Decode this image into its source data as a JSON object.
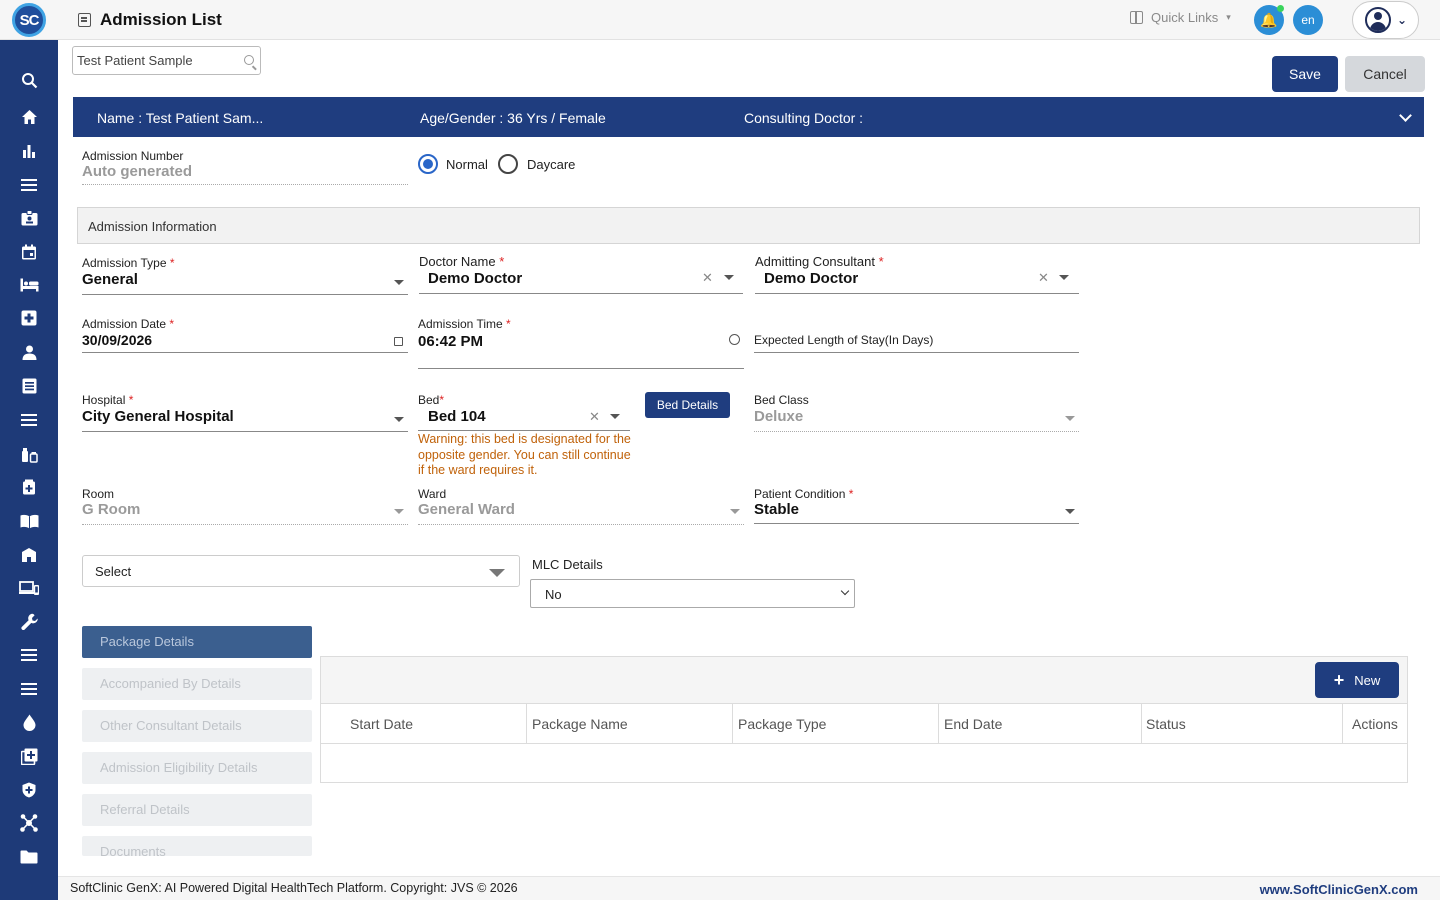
{
  "header": {
    "logo_text": "SC",
    "title": "Admission List",
    "quick_links": "Quick Links",
    "lang": "en"
  },
  "sidebar": {
    "items": [
      "search-icon",
      "home-icon",
      "chart-icon",
      "menu-icon",
      "id-badge-icon",
      "calendar-icon",
      "bed-icon",
      "medical-plus-icon",
      "person-icon",
      "document-list-icon",
      "menu-icon",
      "pharmacy-icon",
      "medicine-box-icon",
      "book-icon",
      "building-icon",
      "devices-icon",
      "wrench-icon",
      "menu-icon",
      "menu-icon",
      "drop-icon",
      "add-box-icon",
      "shield-icon",
      "network-icon",
      "folder-icon"
    ]
  },
  "search": {
    "value": "Test Patient Sample"
  },
  "actions": {
    "save": "Save",
    "cancel": "Cancel"
  },
  "patient": {
    "name": "Name :  Test Patient Sam...",
    "age_gender": "Age/Gender :  36 Yrs / Female",
    "consulting_doctor": "Consulting Doctor :"
  },
  "admission_number": {
    "label": "Admission Number",
    "value": "Auto generated"
  },
  "admission_mode": {
    "normal": "Normal",
    "daycare": "Daycare",
    "selected": "Normal"
  },
  "section_title": "Admission Information",
  "fields": {
    "admission_type": {
      "label": "Admission Type",
      "value": "General"
    },
    "doctor_name": {
      "label": "Doctor Name",
      "value": "Demo Doctor"
    },
    "admitting_consultant": {
      "label": "Admitting Consultant",
      "value": "Demo Doctor"
    },
    "admission_date": {
      "label": "Admission Date",
      "value": "30/09/2026"
    },
    "admission_time": {
      "label": "Admission Time",
      "value": "06:42 PM"
    },
    "expected_stay": {
      "label": "Expected Length of Stay(In Days)"
    },
    "hospital": {
      "label": "Hospital",
      "value": "City General Hospital"
    },
    "bed": {
      "label": "Bed",
      "value": "Bed 104"
    },
    "bed_details_button": "Bed Details",
    "bed_class": {
      "label": "Bed Class",
      "value": "Deluxe"
    },
    "bed_warning": "Warning: this bed is designated for the opposite gender. You can still continue if the ward requires it.",
    "room": {
      "label": "Room",
      "value": "G Room"
    },
    "ward": {
      "label": "Ward",
      "value": "General Ward"
    },
    "patient_condition": {
      "label": "Patient Condition",
      "value": "Stable"
    },
    "select": {
      "value": "Select"
    },
    "mlc": {
      "label": "MLC Details",
      "value": "No"
    }
  },
  "tabs": [
    "Package Details",
    "Accompanied By Details",
    "Other Consultant Details",
    "Admission Eligibility Details",
    "Referral Details",
    "Documents"
  ],
  "grid": {
    "new_button": "New",
    "columns": [
      "Start Date",
      "Package Name",
      "Package Type",
      "End Date",
      "Status",
      "Actions"
    ]
  },
  "footer": {
    "copyright": "SoftClinic GenX: AI Powered Digital HealthTech Platform. Copyright: JVS © 2026",
    "website": "www.SoftClinicGenX.com"
  },
  "colors": {
    "primary": "#1f3d7f",
    "sidebar": "#1e3a78",
    "accent": "#2b8ed6",
    "warning": "#c0620a"
  }
}
